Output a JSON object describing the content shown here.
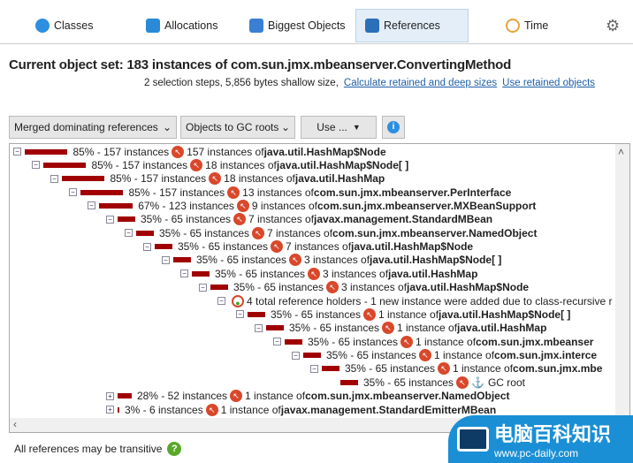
{
  "tabs": [
    {
      "label": "Classes",
      "icon": "classes-icon",
      "color": "#2d8fe0"
    },
    {
      "label": "Allocations",
      "icon": "allocations-icon",
      "color": "#2a8ad8"
    },
    {
      "label": "Biggest Objects",
      "icon": "biggest-objects-icon",
      "color": "#3b7fd4"
    },
    {
      "label": "References",
      "icon": "references-icon",
      "color": "#2b6fb8",
      "active": true
    },
    {
      "label": "Time",
      "icon": "clock-icon",
      "color": "#e8a23a"
    }
  ],
  "header": {
    "title": "Current object set:  183 instances of com.sun.jmx.mbeanserver.ConvertingMethod",
    "subtitle": "2 selection steps, 5,856 bytes shallow size,",
    "link1": "Calculate retained and deep sizes",
    "link2": "Use retained objects"
  },
  "toolbar": {
    "view": "Merged dominating references",
    "direction": "Objects to GC roots",
    "use": "Use ..."
  },
  "tree": [
    {
      "level": 0,
      "exp": "-",
      "pct": 85,
      "label": "85% - 157 instances",
      "prefix": "157 instances of ",
      "cls": "java.util.HashMap$Node"
    },
    {
      "level": 1,
      "exp": "-",
      "pct": 85,
      "label": "85% - 157 instances",
      "prefix": "18 instances of ",
      "cls": "java.util.HashMap$Node[ ]"
    },
    {
      "level": 2,
      "exp": "-",
      "pct": 85,
      "label": "85% - 157 instances",
      "prefix": "18 instances of ",
      "cls": "java.util.HashMap"
    },
    {
      "level": 3,
      "exp": "-",
      "pct": 85,
      "label": "85% - 157 instances",
      "prefix": "13 instances of ",
      "cls": "com.sun.jmx.mbeanserver.PerInterface"
    },
    {
      "level": 4,
      "exp": "-",
      "pct": 67,
      "label": "67% - 123 instances",
      "prefix": "9 instances of ",
      "cls": "com.sun.jmx.mbeanserver.MXBeanSupport"
    },
    {
      "level": 5,
      "exp": "-",
      "pct": 35,
      "label": "35% - 65 instances",
      "prefix": "7 instances of ",
      "cls": "javax.management.StandardMBean"
    },
    {
      "level": 6,
      "exp": "-",
      "pct": 35,
      "label": "35% - 65 instances",
      "prefix": "7 instances of ",
      "cls": "com.sun.jmx.mbeanserver.NamedObject"
    },
    {
      "level": 7,
      "exp": "-",
      "pct": 35,
      "label": "35% - 65 instances",
      "prefix": "7 instances of ",
      "cls": "java.util.HashMap$Node"
    },
    {
      "level": 8,
      "exp": "-",
      "pct": 35,
      "label": "35% - 65 instances",
      "prefix": "3 instances of ",
      "cls": "java.util.HashMap$Node[ ]"
    },
    {
      "level": 9,
      "exp": "-",
      "pct": 35,
      "label": "35% - 65 instances",
      "prefix": "3 instances of ",
      "cls": "java.util.HashMap"
    },
    {
      "level": 10,
      "exp": "-",
      "pct": 35,
      "label": "35% - 65 instances",
      "prefix": "3 instances of ",
      "cls": "java.util.HashMap$Node"
    },
    {
      "level": 11,
      "exp": "-",
      "holder": true,
      "label": "4 total reference holders - 1 new instance were added due to class-recursive r"
    },
    {
      "level": 12,
      "exp": "-",
      "pct": 35,
      "label": "35% - 65 instances",
      "prefix": "1 instance of ",
      "cls": "java.util.HashMap$Node[ ]"
    },
    {
      "level": 13,
      "exp": "-",
      "pct": 35,
      "label": "35% - 65 instances",
      "prefix": "1 instance of ",
      "cls": "java.util.HashMap"
    },
    {
      "level": 14,
      "exp": "-",
      "pct": 35,
      "label": "35% - 65 instances",
      "prefix": "1 instance of ",
      "cls": "com.sun.jmx.mbeanser"
    },
    {
      "level": 15,
      "exp": "-",
      "pct": 35,
      "label": "35% - 65 instances",
      "prefix": "1 instance of ",
      "cls": "com.sun.jmx.interce"
    },
    {
      "level": 16,
      "exp": "-",
      "pct": 35,
      "label": "35% - 65 instances",
      "prefix": "1 instance of ",
      "cls": "com.sun.jmx.mbe"
    },
    {
      "level": 17,
      "exp": "",
      "pct": 35,
      "label": "35% - 65 instances",
      "prefix": "",
      "cls": "",
      "gc": "GC root"
    },
    {
      "level": 5,
      "exp": "+",
      "pct": 28,
      "label": "28% - 52 instances",
      "prefix": "1 instance of ",
      "cls": "com.sun.jmx.mbeanserver.NamedObject"
    },
    {
      "level": 5,
      "exp": "+",
      "pct": 3,
      "label": "3% - 6 instances",
      "prefix": "1 instance of ",
      "cls": "javax.management.StandardEmitterMBean"
    }
  ],
  "footer": {
    "text": "All references may be transitive"
  },
  "watermark": {
    "title": "电脑百科知识",
    "url": "www.pc-daily.com"
  },
  "colors": {
    "bar": "#a00000",
    "accent": "#1f5fa8"
  }
}
